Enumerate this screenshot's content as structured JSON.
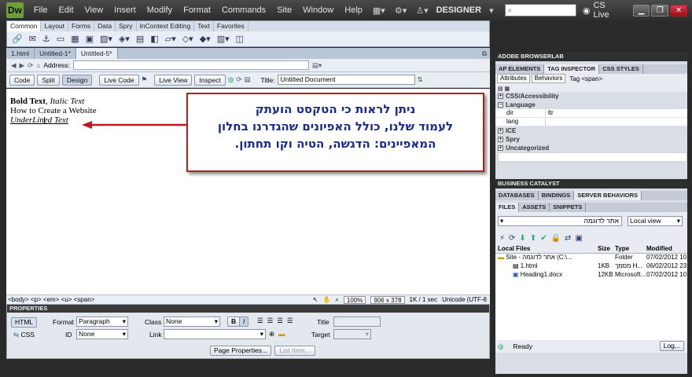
{
  "app": {
    "logo": "Dw",
    "menu": [
      "File",
      "Edit",
      "View",
      "Insert",
      "Modify",
      "Format",
      "Commands",
      "Site",
      "Window",
      "Help"
    ],
    "workspace": "DESIGNER",
    "cs_live": "CS Live"
  },
  "insert_bar": {
    "tabs": [
      "Common",
      "Layout",
      "Forms",
      "Data",
      "Spry",
      "InContext Editing",
      "Text",
      "Favorites"
    ]
  },
  "doc_tabs": [
    "1.html",
    "Untitled-1*",
    "Untitled-5*"
  ],
  "address_label": "Address:",
  "doc_toolbar": {
    "views": [
      "Code",
      "Split",
      "Design"
    ],
    "live_code": "Live Code",
    "live_view": "Live View",
    "inspect": "Inspect",
    "title_label": "Title:",
    "title_value": "Untitled Document"
  },
  "design": {
    "line1_bold": "Bold Text",
    "line1_sep": ", ",
    "line1_italic": "Italic Text",
    "line2": "How to Create a Website",
    "line3": "UnderLined Text"
  },
  "tag_selector": {
    "path": "<body> <p> <em> <u> <span>",
    "zoom": "100%",
    "size": "906 x 378",
    "download": "1K / 1 sec",
    "encoding": "Unicode (UTF-8"
  },
  "properties": {
    "header": "PROPERTIES",
    "html_btn": "HTML",
    "css_btn": "CSS",
    "format_label": "Format",
    "format_value": "Paragraph",
    "id_label": "ID",
    "id_value": "None",
    "class_label": "Class",
    "class_value": "None",
    "link_label": "Link",
    "title_label": "Title",
    "target_label": "Target",
    "bold": "B",
    "italic": "I",
    "page_properties": "Page Properties...",
    "list_item": "List Item..."
  },
  "panels": {
    "browserlab": "ADOBE BROWSERLAB",
    "tag_tabs": [
      "AP ELEMENTS",
      "TAG INSPECTOR",
      "CSS STYLES"
    ],
    "attr_tabs": [
      "Attributes",
      "Behaviors"
    ],
    "tag_label": "Tag <span>",
    "categories": [
      "CSS/Accessibility",
      "Language",
      "ICE",
      "Spry",
      "Uncategorized"
    ],
    "lang_attrs": [
      {
        "k": "dir",
        "v": "ltr"
      },
      {
        "k": "lang",
        "v": ""
      }
    ],
    "business_catalyst": "BUSINESS CATALYST",
    "db_tabs": [
      "DATABASES",
      "BINDINGS",
      "SERVER BEHAVIORS"
    ],
    "files_tabs": [
      "FILES",
      "ASSETS",
      "SNIPPETS"
    ],
    "site_select": "אתר לדוגמה",
    "view_select": "Local view",
    "cols": [
      "Local Files",
      "Size",
      "Type",
      "Modified"
    ],
    "files": [
      {
        "name": "Site - אתר לדוגמה (C:\\...",
        "size": "",
        "type": "Folder",
        "mod": "07/02/2012 10"
      },
      {
        "name": "1.html",
        "size": "1KB",
        "type": "מסמך H...",
        "mod": "06/02/2012 23"
      },
      {
        "name": "Heading1.docx",
        "size": "12KB",
        "type": "Microsoft...",
        "mod": "07/02/2012 10"
      }
    ],
    "status": "Ready",
    "log_btn": "Log..."
  },
  "callout": {
    "line1": "ניתן לראות כי הטקסט הועתק",
    "line2": "לעמוד שלנו, כולל האפיונים שהגדרנו בחלון",
    "line3": "המאפיינים: הדגשה, הטיה וקו תחתון."
  },
  "colors": {
    "callout_border": "#b32020",
    "callout_text": "#1a2a8a",
    "arrow": "#c01818"
  }
}
